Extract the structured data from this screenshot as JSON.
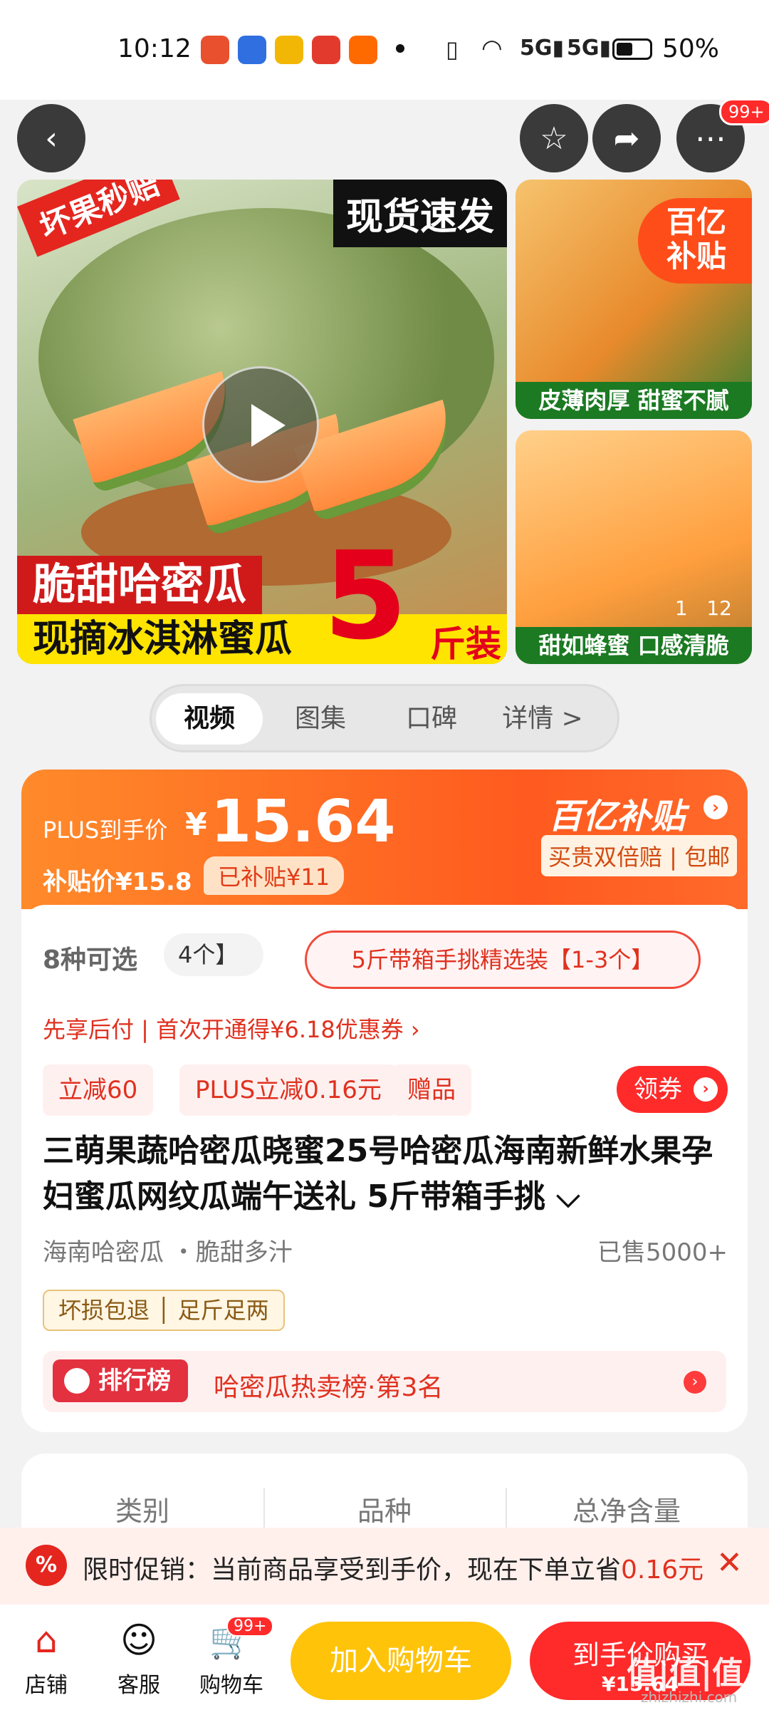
{
  "status_bar": {
    "time": "10:12",
    "battery": "50%"
  },
  "nav": {
    "more_badge": "99+"
  },
  "gallery": {
    "main": {
      "tag_red": "坏果秒赔",
      "tag_black": "现货速发",
      "title_red": "脆甜哈密瓜",
      "title_yellow": "现摘冰淇淋蜜瓜",
      "big_number": "5",
      "unit_text": "斤装"
    },
    "thumb1": {
      "badge_line1": "百亿",
      "badge_line2": "补贴",
      "caption": "皮薄肉厚 甜蜜不腻"
    },
    "thumb2": {
      "counter_current": "1",
      "counter_total": "12",
      "caption": "甜如蜂蜜 口感清脆"
    }
  },
  "tabs": [
    "视频",
    "图集",
    "口碑",
    "详情 >"
  ],
  "price": {
    "plus_label": "PLUS到手价",
    "currency": "¥",
    "value": "15.64",
    "subsidy_line": "补贴价¥15.8",
    "subsidy_tag": "已补贴¥11",
    "logo": "百亿补贴",
    "guarantee": "买贵双倍赔 | 包邮"
  },
  "options": {
    "count_label": "8种可选",
    "option_a": "4个】",
    "option_b": "5斤带箱手挑精选装【1-3个】"
  },
  "pay_later": "先享后付 | 首次开通得¥6.18优惠券 ›",
  "promo_tags": [
    "立减60",
    "PLUS立减0.16元",
    "赠品"
  ],
  "coupon_button": "领券",
  "product": {
    "title": "三萌果蔬哈密瓜晓蜜25号哈密瓜海南新鲜水果孕妇蜜瓜网纹瓜端午送礼 5斤带箱手挑 ⌵",
    "origin": "海南哈密瓜 ・脆甜多汁",
    "sold": "已售5000+",
    "guarantees": "坏损包退 │ 足斤足两"
  },
  "rank": {
    "badge": "排行榜",
    "text": "哈密瓜热卖榜·第3名"
  },
  "specs": [
    "类别",
    "品种",
    "总净含量"
  ],
  "promo_bar": {
    "prefix": "限时促销：当前商品享受到手价，现在下单立省",
    "amount": "0.16元"
  },
  "bottom": {
    "shop": "店铺",
    "service": "客服",
    "cart": "购物车",
    "cart_badge": "99+",
    "add_cart": "加入购物车",
    "buy_line1": "到手价购买",
    "buy_line2": "¥15.64"
  },
  "watermark": {
    "logo": "值|值|值",
    "site": "zhizhizhi.com"
  },
  "colors": {
    "accent": "#ff5a1f",
    "red": "#e0311f",
    "yellow": "#ffc30a"
  }
}
